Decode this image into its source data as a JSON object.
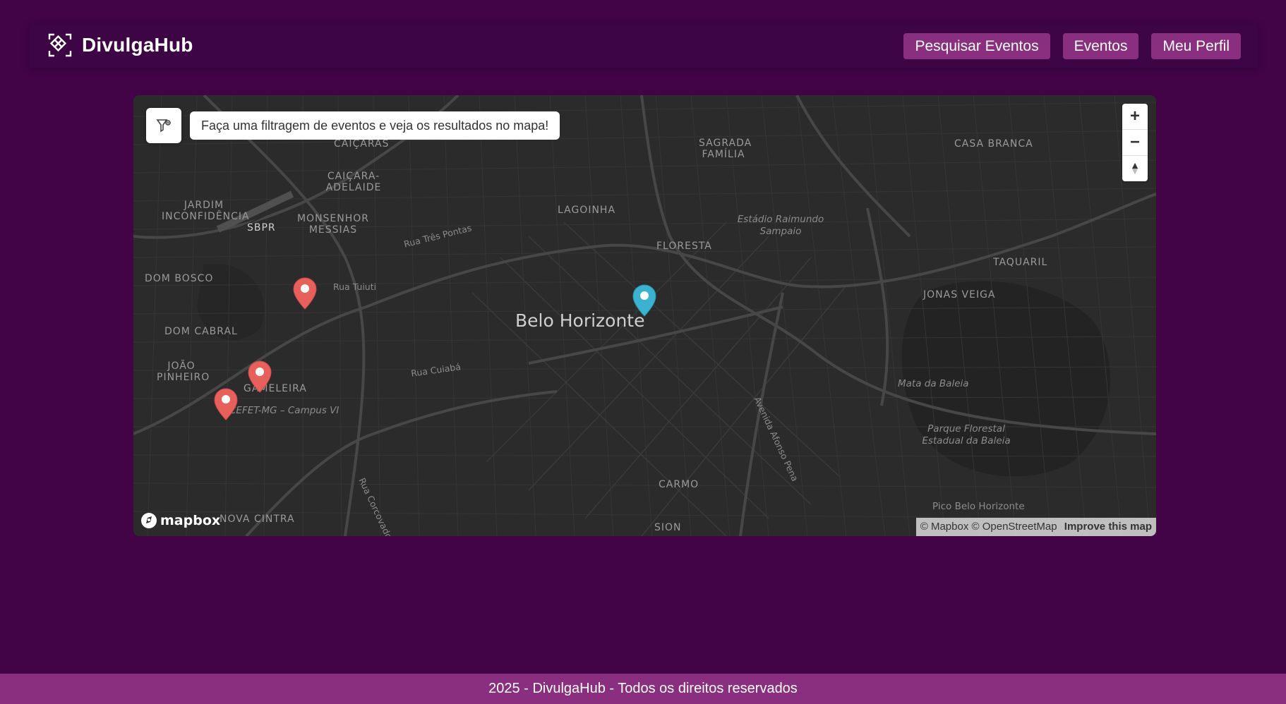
{
  "app": {
    "name": "DivulgaHub",
    "logo_icon": "diamond-grid-icon"
  },
  "nav": {
    "items": [
      {
        "label": "Pesquisar Eventos"
      },
      {
        "label": "Eventos"
      },
      {
        "label": "Meu Perfil"
      }
    ],
    "color": "#8a2f7f"
  },
  "map": {
    "filter_icon": "filter-icon",
    "filter_hint": "Faça uma filtragem de eventos e veja os resultados no mapa!",
    "city": "Belo Horizonte",
    "neighborhoods": [
      "CAIÇARAS",
      "CAIÇARA- ADELAIDE",
      "JARDIM INCONFIDÊNCIA",
      "SBPR",
      "MONSENHOR MESSIAS",
      "DOM BOSCO",
      "DOM CABRAL",
      "JOÃO PINHEIRO",
      "GAMELEIRA",
      "NOVA CINTRA",
      "SAGRADA FAMÍLIA",
      "LAGOINHA",
      "FLORESTA",
      "CASA BRANCA",
      "TAQUARIL",
      "JONAS VEIGA",
      "CARMO",
      "SION"
    ],
    "roads": [
      "Rua Três Pontas",
      "Rua Tuiuti",
      "Rua Cuiabá",
      "Avenida Afonso Pena",
      "Rua Corcovado"
    ],
    "pois": [
      "Estádio Raimundo Sampaio",
      "CEFET-MG – Campus VI",
      "Mata da Baleia",
      "Parque Florestal Estadual da Baleia",
      "Pico Belo Horizonte"
    ],
    "zoom_in": "+",
    "zoom_out": "−",
    "compass": "▲",
    "mapbox": "mapbox",
    "attribution": "© Mapbox © OpenStreetMap",
    "improve": "Improve this map",
    "markers": [
      {
        "type": "event",
        "color": "#e8605c"
      },
      {
        "type": "event",
        "color": "#e8605c"
      },
      {
        "type": "event",
        "color": "#e8605c"
      },
      {
        "type": "user-location",
        "color": "#3bb2d0"
      }
    ]
  },
  "footer": {
    "text": "2025 - DivulgaHub - Todos os direitos reservados"
  }
}
